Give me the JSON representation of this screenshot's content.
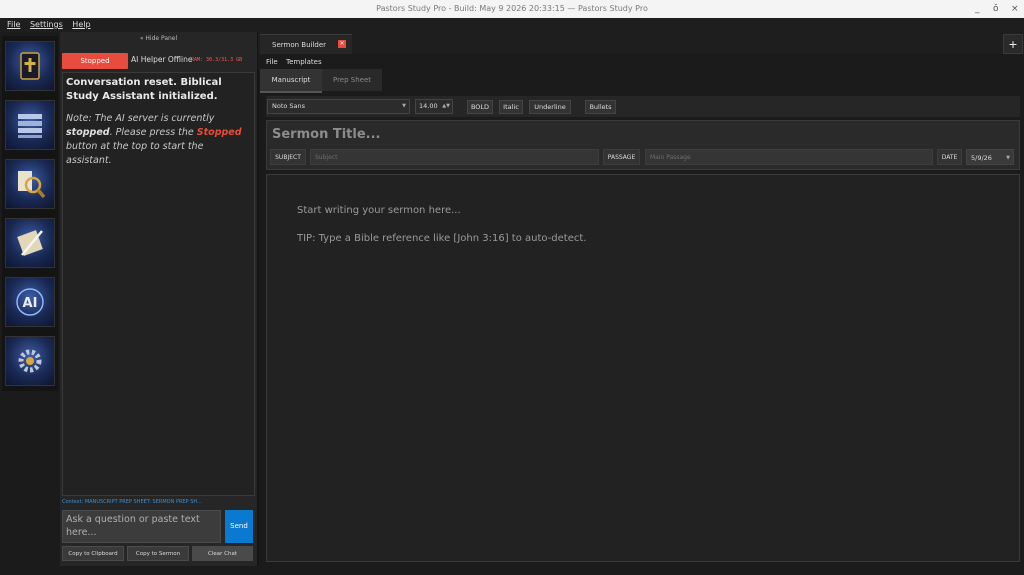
{
  "window": {
    "title": "Pastors Study Pro - Build: May  9 2026 20:33:15 — Pastors Study Pro",
    "controls": [
      "_",
      "ǒ",
      "×"
    ]
  },
  "menubar": [
    "File",
    "Settings",
    "Help"
  ],
  "nav_icons": [
    {
      "name": "bible-icon"
    },
    {
      "name": "library-icon"
    },
    {
      "name": "search-study-icon"
    },
    {
      "name": "scroll-quill-icon"
    },
    {
      "name": "ai-icon"
    },
    {
      "name": "gear-settings-icon"
    }
  ],
  "chat": {
    "hide_panel": "« Hide Panel",
    "stop_button": "Stopped",
    "helper_status": "AI Helper Offline",
    "ram": "RAM: 30.3/31.3 GB",
    "messages": {
      "reset": "Conversation reset. Biblical Study Assistant initialized.",
      "note_prefix": "Note: The AI server is currently ",
      "note_stopped": "stopped",
      "note_mid": ". Please press the ",
      "note_button": "Stopped",
      "note_suffix": " button at the top to start the assistant."
    },
    "context": "Context: MANUSCRIPT   PREP SHEET: SERMON PREP SH...",
    "input_placeholder": "Ask a question or paste text here...",
    "send": "Send",
    "copy_clipboard": "Copy to Clipboard",
    "copy_sermon": "Copy to Sermon",
    "clear_chat": "Clear Chat"
  },
  "main": {
    "tab_label": "Sermon Builder",
    "close_symbol": "✕",
    "add_symbol": "+",
    "submenu": [
      "File",
      "Templates"
    ],
    "subtabs": [
      "Manuscript",
      "Prep Sheet"
    ],
    "toolbar": {
      "font": "Noto Sans",
      "size": "14.00",
      "bold": "BOLD",
      "italic": "Italic",
      "underline": "Underline",
      "bullets": "Bullets"
    },
    "header": {
      "title_placeholder": "Sermon Title...",
      "subject_label": "SUBJECT",
      "subject_placeholder": "Subject",
      "passage_label": "PASSAGE",
      "passage_placeholder": "Main Passage",
      "date_label": "DATE",
      "date_value": "5/9/26"
    },
    "editor": {
      "line1": "Start writing your sermon here...",
      "line2": "TIP: Type a Bible reference like [John 3:16] to auto-detect."
    }
  }
}
